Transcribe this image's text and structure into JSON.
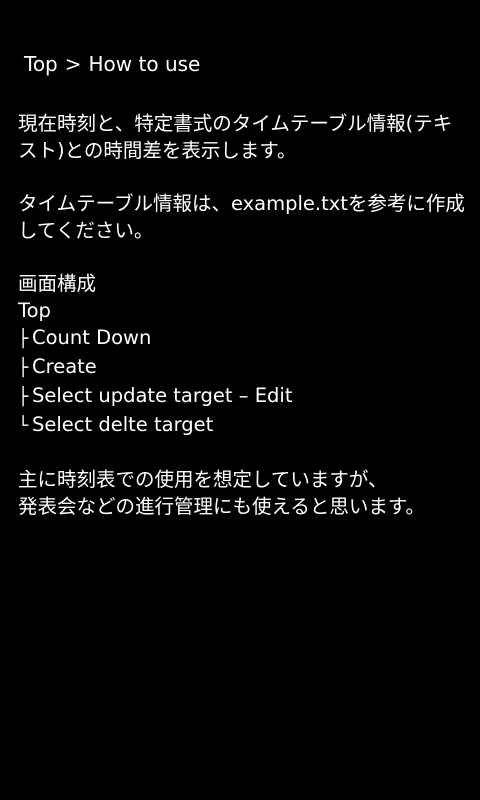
{
  "breadcrumb": {
    "root": "Top",
    "separator": ">",
    "current": "How to use"
  },
  "intro": {
    "line1": "現在時刻と、特定書式のタイムテーブル情報(テキ",
    "line2": "スト)との時間差を表示します。"
  },
  "timetable_note": {
    "line1": "タイムテーブル情報は、example.txtを参考に作成",
    "line2": "してください。"
  },
  "screen_structure": {
    "heading": "画面構成",
    "root": "Top",
    "items": [
      {
        "glyph": "├",
        "label": "Count Down"
      },
      {
        "glyph": "├",
        "label": "Create"
      },
      {
        "glyph": "├",
        "label": "Select update target – Edit"
      },
      {
        "glyph": "└",
        "label": "Select delte target"
      }
    ]
  },
  "usage_note": {
    "line1": "主に時刻表での使用を想定していますが、",
    "line2": "発表会などの進行管理にも使えると思います。"
  },
  "colors": {
    "background": "#000000",
    "text": "#ffffff"
  }
}
